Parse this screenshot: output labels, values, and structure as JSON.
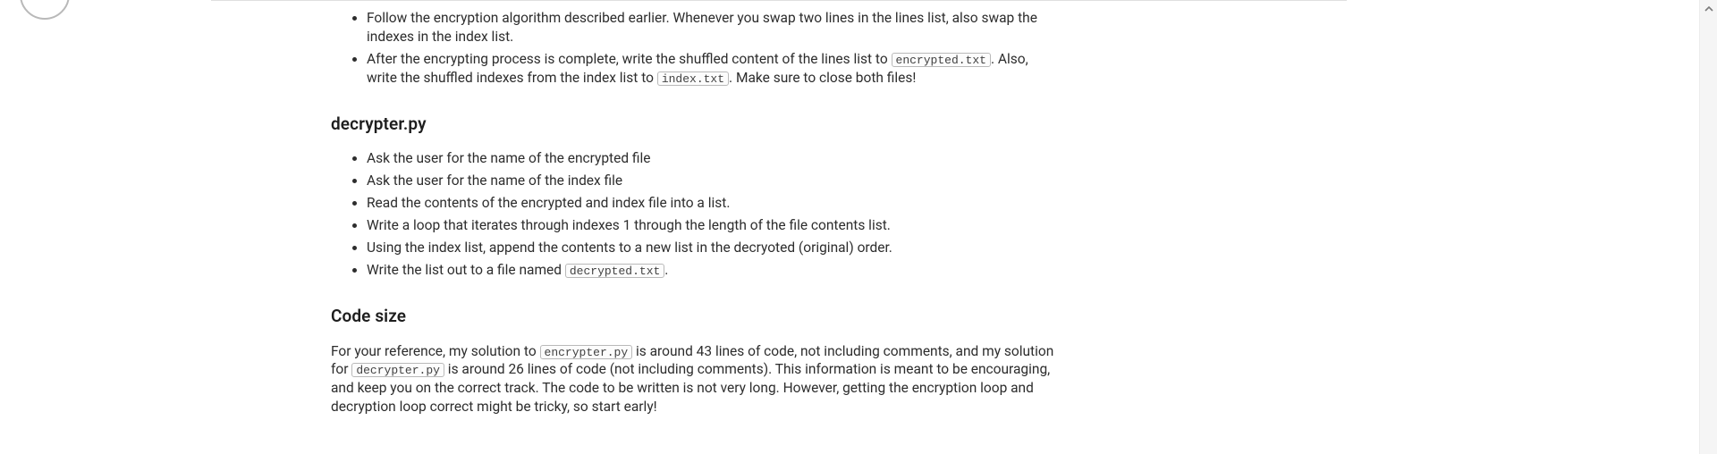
{
  "encrypter_tail": {
    "items": [
      {
        "text_a": "Follow the encryption algorithm described earlier. Whenever you swap two lines in the lines list, also swap the indexes in the index list."
      },
      {
        "text_a": "After the encrypting process is complete, write the shuffled content of the lines list to ",
        "code_a": "encrypted.txt",
        "text_b": ". Also, write the shuffled indexes from the index list to ",
        "code_b": "index.txt",
        "text_c": ". Make sure to close both files!"
      }
    ]
  },
  "decrypter": {
    "heading": "decrypter.py",
    "items": [
      {
        "text_a": "Ask the user for the name of the encrypted file"
      },
      {
        "text_a": "Ask the user for the name of the index file"
      },
      {
        "text_a": "Read the contents of the encrypted and index file into a list."
      },
      {
        "text_a": "Write a loop that iterates through indexes 1 through the length of the file contents list."
      },
      {
        "text_a": "Using the index list, append the contents to a new list in the decryoted (original) order."
      },
      {
        "text_a": "Write the list out to a file named ",
        "code_a": "decrypted.txt",
        "text_b": "."
      }
    ]
  },
  "codesize": {
    "heading": "Code size",
    "para_a": "For your reference, my solution to ",
    "code_a": "encrypter.py",
    "para_b": " is around 43 lines of code, not including comments, and my solution for ",
    "code_b": "decrypter.py",
    "para_c": " is around 26 lines of code (not including comments). This information is meant to be encouraging, and keep you on the correct track. The code to be written is not very long. However, getting the encryption loop and decryption loop correct might be tricky, so start early!"
  }
}
